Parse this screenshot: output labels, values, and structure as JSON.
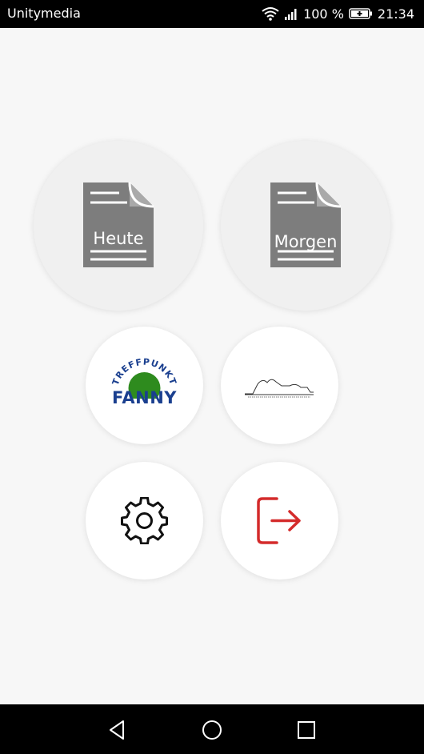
{
  "status_bar": {
    "carrier": "Unitymedia",
    "battery_percent": "100 %",
    "time": "21:34",
    "icons": [
      "wifi-icon",
      "signal-icon",
      "battery-charging-icon"
    ]
  },
  "buttons": {
    "heute": {
      "label": "Heute",
      "icon": "document-icon"
    },
    "morgen": {
      "label": "Morgen",
      "icon": "document-icon"
    },
    "fanny": {
      "logo_top": "TREFFPUNKT",
      "logo_bottom": "FANNY",
      "icon": "treffpunkt-fanny-logo"
    },
    "turnhalle": {
      "icon": "building-outline-logo"
    },
    "settings": {
      "icon": "gear-icon"
    },
    "logout": {
      "icon": "logout-icon"
    }
  },
  "colors": {
    "doc_gray": "#7d7d7d",
    "fanny_blue": "#1a3f8f",
    "fanny_green": "#2e8b1e",
    "logout_red": "#d42b2b"
  },
  "nav_bar": {
    "icons": [
      "back-icon",
      "home-icon",
      "recents-icon"
    ]
  }
}
